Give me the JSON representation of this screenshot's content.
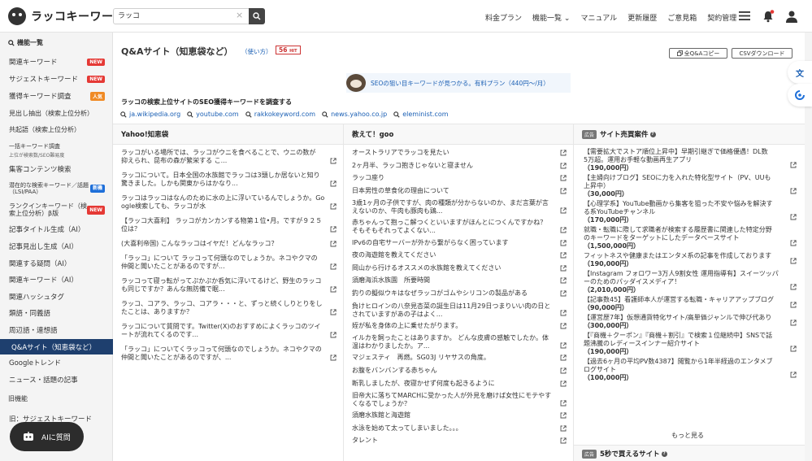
{
  "header": {
    "logo_text": "ラッコキーワード",
    "search_value": "ラッコ",
    "nav": [
      "料金プラン",
      "機能一覧",
      "マニュアル",
      "更新履歴",
      "ご意見箱",
      "契約管理"
    ],
    "nav_chevron": "⌄"
  },
  "sidebar": {
    "section_label": "機能一覧",
    "items": [
      {
        "label": "関連キーワード",
        "badge": "NEW",
        "badge_color": "#e53935"
      },
      {
        "label": "サジェストキーワード",
        "badge": "NEW",
        "badge_color": "#e53935"
      },
      {
        "label": "獲得キーワード調査",
        "badge": "人気",
        "badge_color": "#f08a24"
      },
      {
        "label": "見出し抽出（検索上位分析）"
      },
      {
        "label": "共起語（検索上位分析）"
      },
      {
        "label": "一括キーワード調査",
        "sub": "上位が検索数/SEO難易度"
      },
      {
        "label": "集客コンテンツ検索"
      },
      {
        "label": "潜在的な検索キーワード／話題（LSI/PAA）",
        "badge": "新機",
        "badge_color": "#1e6fd9"
      },
      {
        "label": "ランクインキーワード（検索上位分析）β版",
        "badge": "NEW",
        "badge_color": "#e53935"
      },
      {
        "label": "記事タイトル生成（AI）"
      },
      {
        "label": "記事見出し生成（AI）"
      },
      {
        "label": "関連する疑問（AI）"
      },
      {
        "label": "関連キーワード（AI）"
      },
      {
        "label": "関連ハッシュタグ"
      },
      {
        "label": "類語・同義語"
      },
      {
        "label": "周辺語・連想語"
      },
      {
        "label": "Q&Aサイト（知恵袋など）",
        "active": true
      },
      {
        "label": "Googleトレンド"
      },
      {
        "label": "ニュース・話題の記事"
      }
    ],
    "old_section": "旧機能",
    "old_items": [
      "旧：サジェストキーワード"
    ],
    "ai_button": "AIに質問"
  },
  "main": {
    "title": "Q&Aサイト（知恵袋など）",
    "howto": "（使い方）",
    "hit_count": "56",
    "hit_unit": "HIT",
    "copy_button": "全Q&Aコピー",
    "csv_button": "CSVダウンロード",
    "promo": "SEOの狙い目キーワードが見つかる。有料プラン（440円〜/月）",
    "section_title": "ラッコの検索上位サイトのSEO獲得キーワードを調査する",
    "site_links": [
      "ja.wikipedia.org",
      "youtube.com",
      "rakkokeyword.com",
      "news.yahoo.co.jp",
      "eleminist.com"
    ]
  },
  "yahoo": {
    "title": "Yahoo!知恵袋",
    "items": [
      {
        "l1": "ラッコがいる場所では、ラッコがウニを食べることで、ウニの数が",
        "l2": "抑えられ、昆布の森が繁栄する こ..."
      },
      {
        "l1": "ラッコについて。日本全国の水族館でラッコは3頭しか居ないと知り",
        "l2": "驚きました。しかも関東からはかなり..."
      },
      {
        "l1": "ラッコはラッコはなんのために水の上に浮いているんでしょうか。Go",
        "l2": "ogle検索しても、ラッコが水"
      },
      {
        "l1": "【ラッコ大喜利】 ラッコがカンカンする物第１位•月。ですが９２５",
        "l2": "位は？"
      },
      {
        "l1": "(大喜利帝国) こんなラッコはイヤだ！どんなラッコ？",
        "l2": ""
      },
      {
        "l1": "「ラッコ」について ラッコって何頭なのでしょうか。ネコやクマの",
        "l2": "仲間と聞いたことがあるのですが..."
      },
      {
        "l1": "ラッコって寝っ転がってぷかぷか呑気に浮いてるけど、野生のラッコ",
        "l2": "も同じですか？あんな無防備で眠..."
      },
      {
        "l1": "ラッコ、コアラ、ラッコ、コアラ・・・と、ずっと続くしりとりをし",
        "l2": "たことは、ありますか？"
      },
      {
        "l1": "ラッコについて質問です。Twitter(X)のおすすめによくラッコのツイ",
        "l2": "ートが流れてくるのです..."
      },
      {
        "l1": "「ラッコ」についてくラッコって何頭なのでしょうか。ネコやクマの",
        "l2": "仲間と聞いたことがあるのですが、..."
      }
    ]
  },
  "oshiete": {
    "title": "教えて！goo",
    "items": [
      {
        "l1": "オーストラリアでラッコを見たい",
        "l2": ""
      },
      {
        "l1": "2ヶ月半、ラッコ抱きじゃないと寝ません",
        "l2": ""
      },
      {
        "l1": "ラッコ座り",
        "l2": ""
      },
      {
        "l1": "日本男性の草食化の理由について",
        "l2": ""
      },
      {
        "l1": "3歳1ヶ月の子供ですが、肉の種類が分からないのか、まだ言葉が言",
        "l2": "えないのか、牛肉も豚肉も鶏..."
      },
      {
        "l1": "赤ちゃんって抱っこ解つくといいますがほんとにつくんですかね？",
        "l2": "そもそもそれってよくない..."
      },
      {
        "l1": "IPv6の自宅サーバーが外から繋がらなく困っています",
        "l2": ""
      },
      {
        "l1": "夜の海遊館を教えてください",
        "l2": ""
      },
      {
        "l1": "岡山から行けるオススメの水族館を教えてください",
        "l2": ""
      },
      {
        "l1": "須磨海浜水族園　所要時間",
        "l2": ""
      },
      {
        "l1": "釣りの擬似ウキはなぜラッコがゴムやシリコンの製品がある",
        "l2": ""
      },
      {
        "l1": "負けヒロインの八奈見杏菜の誕生日は11月29日つまりいい肉の日と",
        "l2": "されていますがあの子はよく..."
      },
      {
        "l1": "姪が私を身体の上に乗せたがります。",
        "l2": ""
      },
      {
        "l1": "イルカを飼ったことはありますか。 どんな皮膚の感触でしたか。体",
        "l2": "温はわかりましたか。ア..."
      },
      {
        "l1": "マジェスティ　再燃。SG03J リヤサスの角度。",
        "l2": ""
      },
      {
        "l1": "お腹をバンバンする赤ちゃん",
        "l2": ""
      },
      {
        "l1": "断乳しましたが、夜寝かせず何度も起きるように",
        "l2": ""
      },
      {
        "l1": "旧帝大に落ちてMARCHに受かった人が外見を磨けば女性にモテやす",
        "l2": "くなるでしょうか？"
      },
      {
        "l1": "須磨水族館と海遊館",
        "l2": ""
      },
      {
        "l1": "水泳を始めて太ってしまいました。。。",
        "l2": ""
      },
      {
        "l1": "タレント",
        "l2": ""
      }
    ]
  },
  "ads": {
    "tag": "広告",
    "title": "サイト売買案件",
    "items": [
      {
        "l1": "【需要拡大でストア順位上昇中】早期引継ぎで価格優遇！DL数",
        "l2": "5万超。運用お手軽な動画再生アプリ",
        "price": "（190,000円）"
      },
      {
        "l1": "【主婦向けブログ】SEOに力を入れた特化型サイト（PV、UUも",
        "l2": "上昇中）",
        "price": "（30,000円）"
      },
      {
        "l1": "【心理学系】YouTube動画から集客を狙った不安や悩みを解決す",
        "l2": "る系YouTubeチャンネル",
        "price": "（170,000円）"
      },
      {
        "l1": "就職・転職に際して求職者が検索する履歴書に関連した特定分野",
        "l2": "のキーワードをターゲットにしたデータベースサイト",
        "price": "（1,500,000円）"
      },
      {
        "l1": "フィットネスや健康またはエンタメ系の記事を作成しております",
        "l2": "",
        "price": "（190,000円）"
      },
      {
        "l1": "【Instagram フォロワー3万人9割女性 運用指導有】スイーツッパ",
        "l2": "ーのためのパッダイスメディア！",
        "price": "（2,010,000円）"
      },
      {
        "l1": "【記事数45】看護師本人が運営する転職・キャリアアップブログ",
        "l2": "",
        "price": "（90,000円）"
      },
      {
        "l1": "【運営歴7年】仮想通貨特化サイト/高単価ジャンルで伸び代あり",
        "l2": "",
        "price": "（300,000円）"
      },
      {
        "l1": "【『商機＋クーポン』『商機＋割引』で検索１位継続中】SNSで話",
        "l2": "題沸騰のレディースインナー紹介サイト",
        "price": "（190,000円）"
      },
      {
        "l1": "【過去6ヶ月の平均PV数4387】閲覧から1年半経過のエンタメブ",
        "l2": "ログサイト",
        "price": "（100,000円）"
      }
    ],
    "more": "もっと見る",
    "tag2": "広告",
    "title2": "5秒で買えるサイト"
  }
}
